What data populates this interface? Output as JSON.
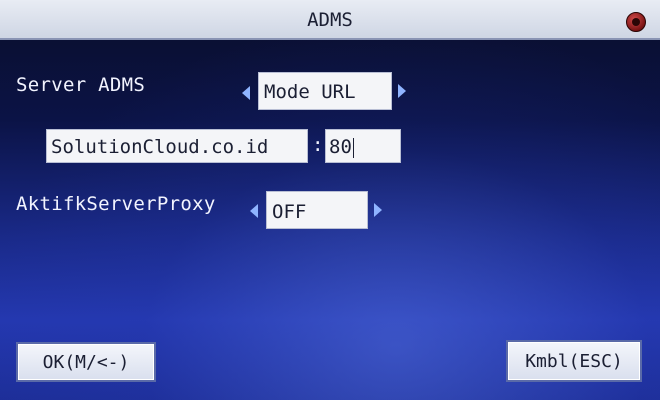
{
  "window": {
    "title": "ADMS"
  },
  "form": {
    "server_label": "Server ADMS",
    "server_mode_value": "Mode URL",
    "url_value": "SolutionCloud.co.id",
    "separator": ":",
    "port_value": "80",
    "proxy_label": "AktifkServerProxy",
    "proxy_value": "OFF"
  },
  "buttons": {
    "ok_label": "OK(M/<-)",
    "back_label": "Kmbl(ESC)"
  }
}
